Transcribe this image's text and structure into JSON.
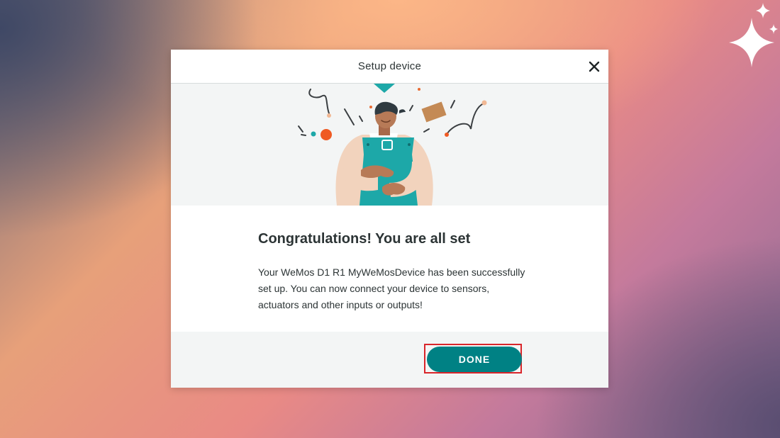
{
  "dialog": {
    "title": "Setup device",
    "close_icon": "close-icon",
    "headline": "Congratulations! You are all set",
    "message": "Your WeMos D1 R1 MyWeMosDevice has been successfully set up. You can now connect your device to sensors, actuators and other inputs or outputs!",
    "done_label": "DONE"
  },
  "illustration": {
    "subject": "person-hugging-device-icon"
  },
  "decor": {
    "sparkle_icon": "sparkle-icon"
  },
  "colors": {
    "accent": "#008184",
    "highlight": "#d9252a",
    "header_divider": "#d6dcdc",
    "panel_background": "#f3f5f5"
  }
}
